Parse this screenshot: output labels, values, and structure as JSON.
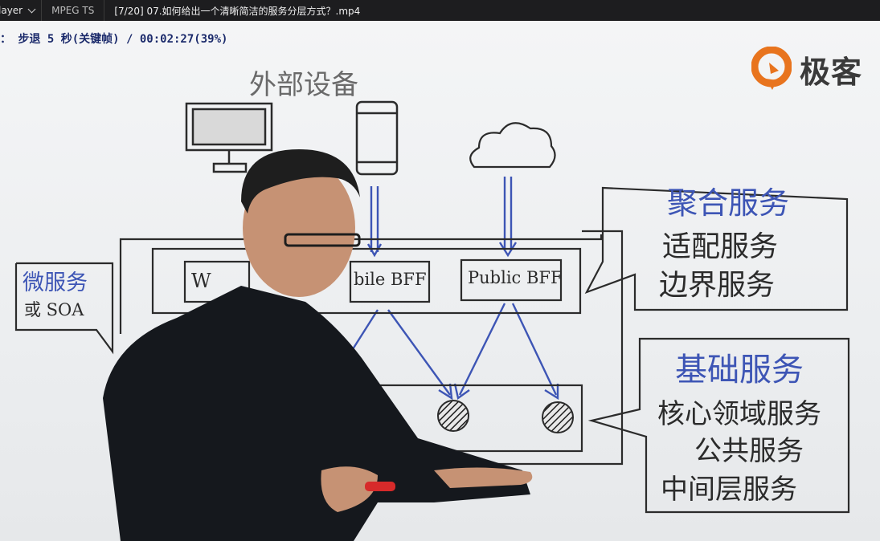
{
  "titlebar": {
    "app_label": "layer",
    "format_label": "MPEG TS",
    "file_title": "[7/20] 07.如何给出一个清晰简洁的服务分层方式？.mp4"
  },
  "osd": {
    "text": "： 步退 5 秒(关键帧) / 00:02:27(39%)"
  },
  "logo": {
    "text": "极客",
    "brand_color": "#e8741e"
  },
  "whiteboard": {
    "external_devices": "外部设备",
    "microservice_title": "微服务",
    "microservice_sub": "或 SOA",
    "bff_web": "W",
    "bff_mobile": "bile BFF",
    "bff_public": "Public BFF",
    "aggregation_title": "聚合服务",
    "aggregation_items": [
      "适配服务",
      "边界服务"
    ],
    "base_title": "基础服务",
    "base_items": [
      "核心领域服务",
      "公共服务",
      "中间层服务"
    ]
  },
  "colors": {
    "ink_blue": "#3d55b5",
    "ink_dark": "#2b2b2b"
  }
}
